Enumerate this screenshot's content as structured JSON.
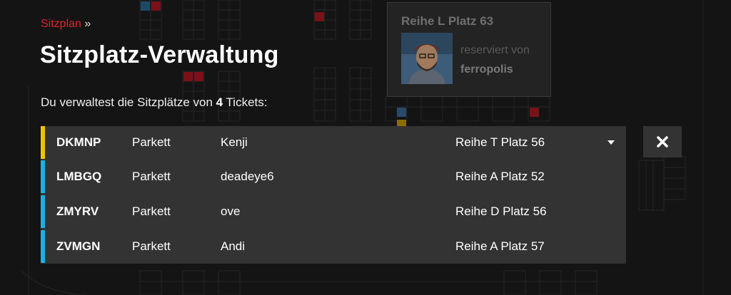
{
  "breadcrumb": {
    "link": "Sitzplan",
    "separator": "»"
  },
  "title": "Sitzplatz-Verwaltung",
  "intro": {
    "before": "Du verwaltest die Sitzplätze von ",
    "count": "4",
    "after": " Tickets:"
  },
  "tooltip": {
    "title": "Reihe L Platz 63",
    "label": "reserviert von",
    "user": "ferropolis"
  },
  "tickets": [
    {
      "code": "DKMNP",
      "category": "Parkett",
      "holder": "Kenji",
      "seat": "Reihe T Platz 56",
      "color": "#f2c200",
      "selected": true
    },
    {
      "code": "LMBGQ",
      "category": "Parkett",
      "holder": "deadeye6",
      "seat": "Reihe A Platz 52",
      "color": "#1eaee6",
      "selected": false
    },
    {
      "code": "ZMYRV",
      "category": "Parkett",
      "holder": "ove",
      "seat": "Reihe D Platz 56",
      "color": "#1eaee6",
      "selected": false
    },
    {
      "code": "ZVMGN",
      "category": "Parkett",
      "holder": "Andi",
      "seat": "Reihe A Platz 57",
      "color": "#1eaee6",
      "selected": false
    }
  ],
  "icons": {
    "dropdown": "chevron-down-icon",
    "close": "close-icon"
  },
  "colors": {
    "accent": "#e5202e",
    "panel": "#333333",
    "background": "#141414"
  }
}
